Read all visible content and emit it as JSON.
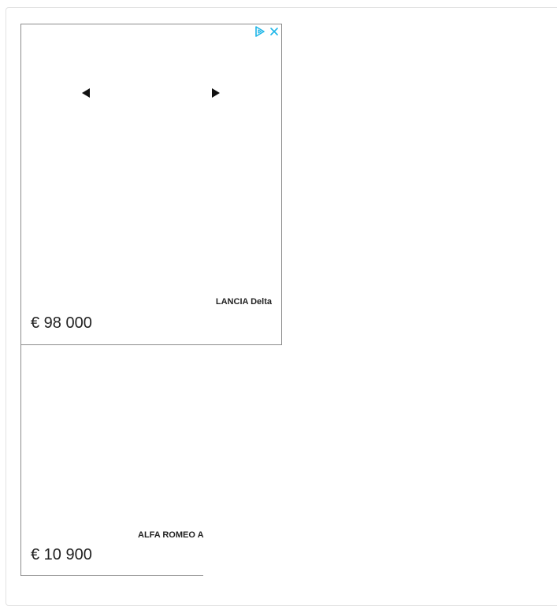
{
  "ad": {
    "adchoices_icon": "adchoices-triangle-icon",
    "close_icon": "close-x-icon",
    "accent_color": "#1fb6e8",
    "nav": {
      "prev_icon": "triangle-left-icon",
      "next_icon": "triangle-right-icon"
    },
    "cards": [
      {
        "title": "LANCIA Delta",
        "price": "€ 98 000"
      },
      {
        "title": "ALFA ROMEO A",
        "price": "€ 10 900"
      }
    ]
  }
}
